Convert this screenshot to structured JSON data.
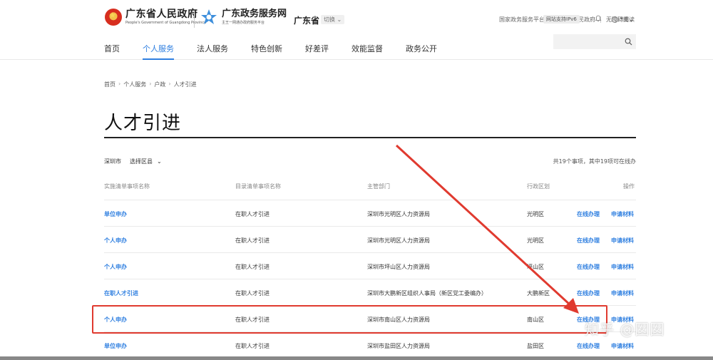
{
  "header": {
    "gov_name": "广东省人民政府",
    "gov_name_en": "People's Government of Guangdong Province",
    "service_name": "广东政务服务网",
    "service_slogan": "主王一网通办政府服务平台",
    "province": "广东省",
    "switch_label": "切换",
    "top_links": [
      "国家政务服务平台",
      "广东省人民政府",
      "无障碍阅读"
    ],
    "ipv6_label": "网站支持IPv6",
    "user_label": "*南"
  },
  "nav": {
    "items": [
      "首页",
      "个人服务",
      "法人服务",
      "特色创新",
      "好差评",
      "效能监督",
      "政务公开"
    ],
    "active": "个人服务"
  },
  "search": {
    "placeholder": ""
  },
  "breadcrumb": [
    "首页",
    "个人服务",
    "户政",
    "人才引进"
  ],
  "page_title": "人才引进",
  "filter": {
    "city": "深圳市",
    "county_label": "选择区县"
  },
  "summary": "共19个事项，其中19项可在线办",
  "table": {
    "headers": [
      "实施清单事项名称",
      "目录清单事项名称",
      "主管部门",
      "行政区划",
      "操作"
    ],
    "rows": [
      {
        "name": "单位申办",
        "catalog": "在职人才引进",
        "dept": "深圳市光明区人力资源局",
        "region": "光明区",
        "action1": "在线办理",
        "action2": "申请材料"
      },
      {
        "name": "个人申办",
        "catalog": "在职人才引进",
        "dept": "深圳市光明区人力资源局",
        "region": "光明区",
        "action1": "在线办理",
        "action2": "申请材料"
      },
      {
        "name": "个人申办",
        "catalog": "在职人才引进",
        "dept": "深圳市坪山区人力资源局",
        "region": "坪山区",
        "action1": "在线办理",
        "action2": "申请材料"
      },
      {
        "name": "在职人才引进",
        "catalog": "在职人才引进",
        "dept": "深圳市大鹏新区组织人事局（新区党工委编办）",
        "region": "大鹏新区",
        "action1": "在线办理",
        "action2": "申请材料"
      },
      {
        "name": "个人申办",
        "catalog": "在职人才引进",
        "dept": "深圳市南山区人力资源局",
        "region": "南山区",
        "action1": "在线办理",
        "action2": "申请材料"
      },
      {
        "name": "单位申办",
        "catalog": "在职人才引进",
        "dept": "深圳市盐田区人力资源局",
        "region": "盐田区",
        "action1": "在线办理",
        "action2": "申请材料"
      }
    ]
  },
  "watermark": "知乎 @囡囡",
  "colors": {
    "accent": "#2f7fe0",
    "annotation_red": "#e03a2f"
  }
}
